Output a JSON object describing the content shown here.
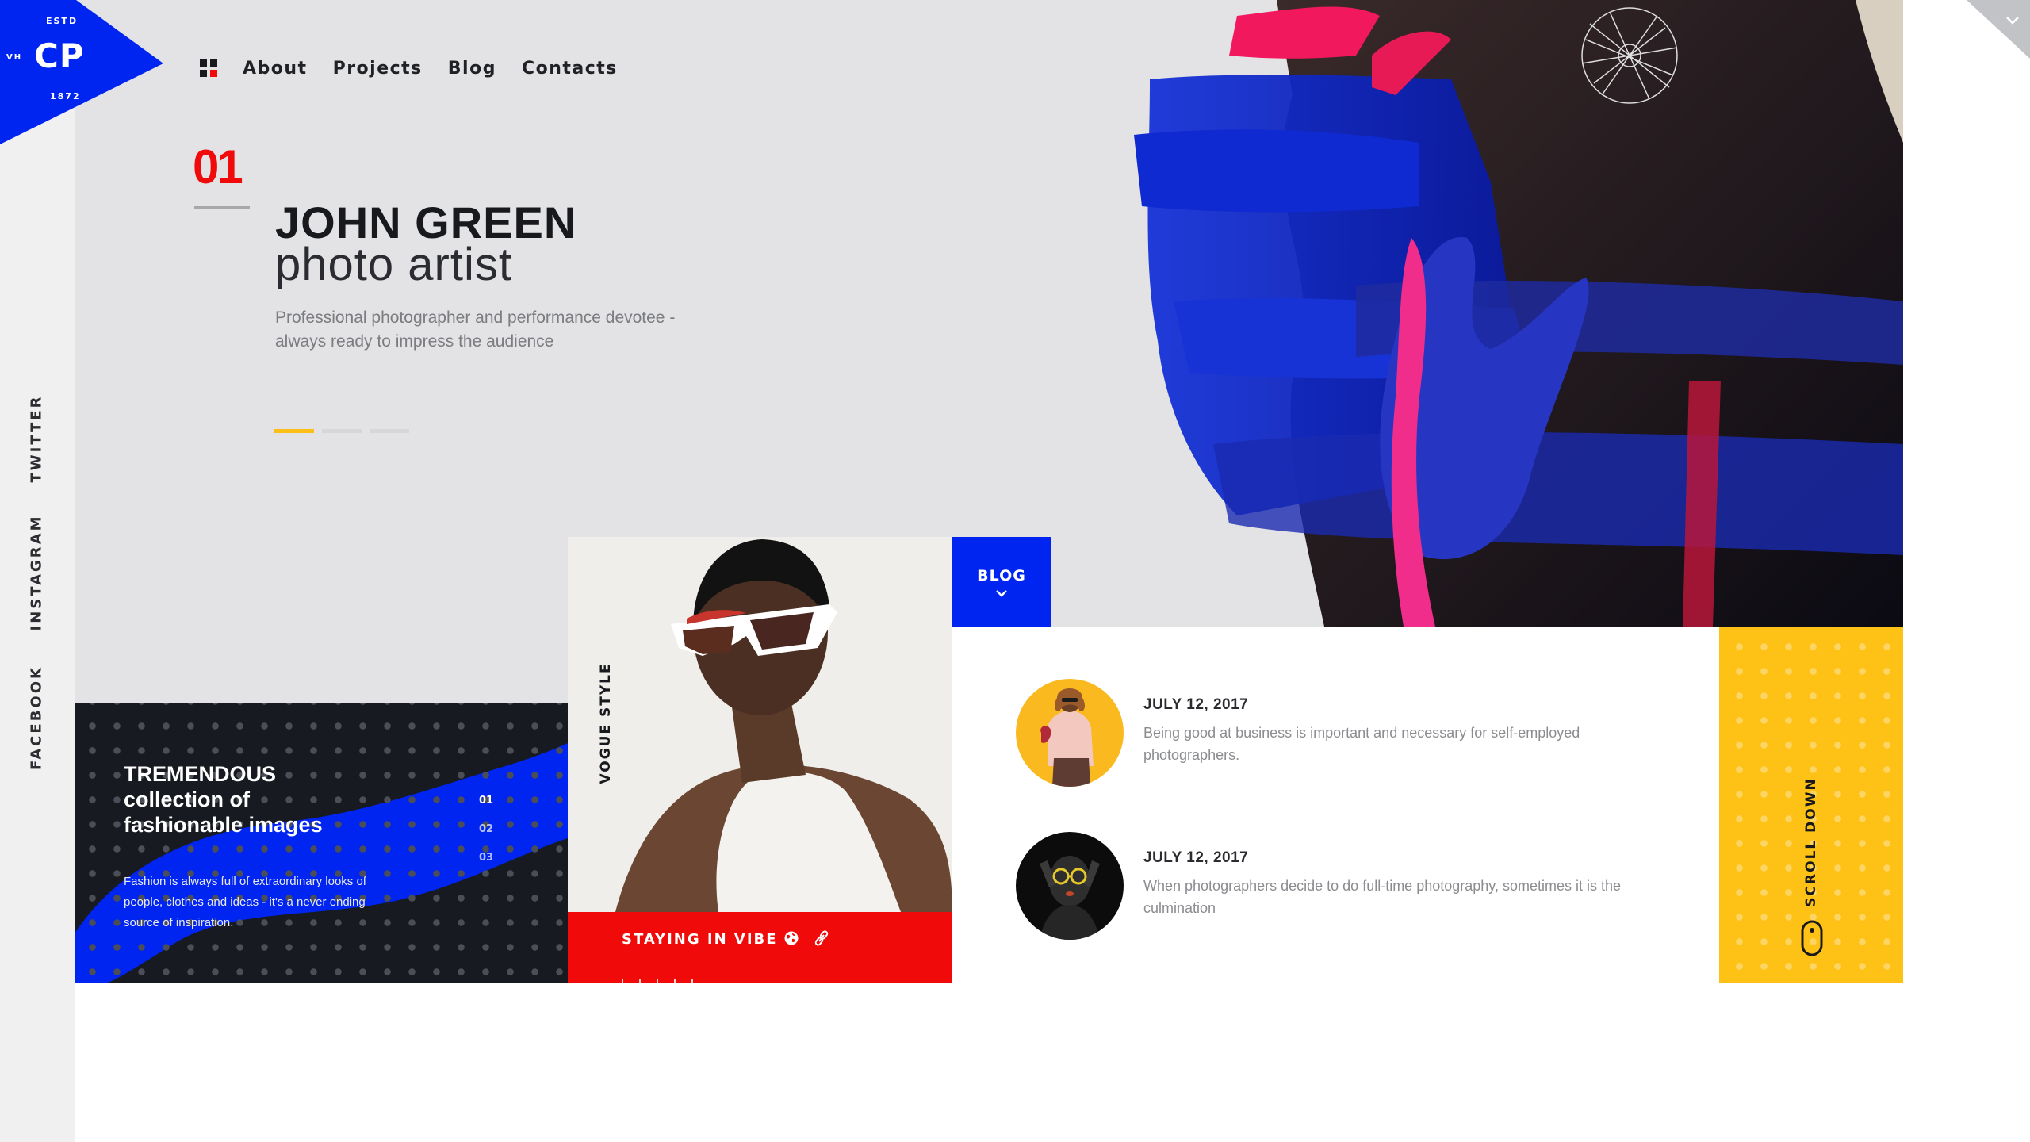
{
  "logo": {
    "estd": "ESTD",
    "initials": "CP",
    "side": "VH",
    "year": "1872",
    "color": "#0025f0"
  },
  "nav": {
    "menu_icon": "grid-menu-icon",
    "links": [
      "About",
      "Projects",
      "Blog",
      "Contacts"
    ]
  },
  "social": [
    "TWITTER",
    "INSTAGRAM",
    "FACEBOOK"
  ],
  "hero": {
    "slide_number": "01",
    "name": "JOHN GREEN",
    "role": "photo artist",
    "description": "Professional photographer and performance devotee - always ready to impress the audience",
    "slides_total": 3,
    "active_slide": 1
  },
  "feature": {
    "title_line1": "TREMENDOUS",
    "title_line2": "collection of",
    "title_line3": "fashionable images",
    "description": "Fashion is always full of extraordinary looks of people, clothes and ideas - it's a never ending source of inspiration.",
    "numbers": [
      "01",
      "02",
      "03"
    ]
  },
  "card": {
    "vertical_label": "VOGUE STYLE",
    "title": "STAYING IN VIBE",
    "icons": [
      "globe-icon",
      "link-icon"
    ]
  },
  "blog": {
    "tab_label": "BLOG",
    "posts": [
      {
        "date": "JULY 12, 2017",
        "text": "Being good at business is important and necessary for self-employed photographers."
      },
      {
        "date": "JULY 12, 2017",
        "text": "When photographers decide to do full-time photography, sometimes it is the culmination"
      }
    ]
  },
  "scroll": {
    "label": "SCROLL DOWN"
  },
  "colors": {
    "blue": "#0025f0",
    "red": "#f00a0a",
    "yellow": "#fec217",
    "dark": "#171a20",
    "background": "#e3e3e5"
  }
}
